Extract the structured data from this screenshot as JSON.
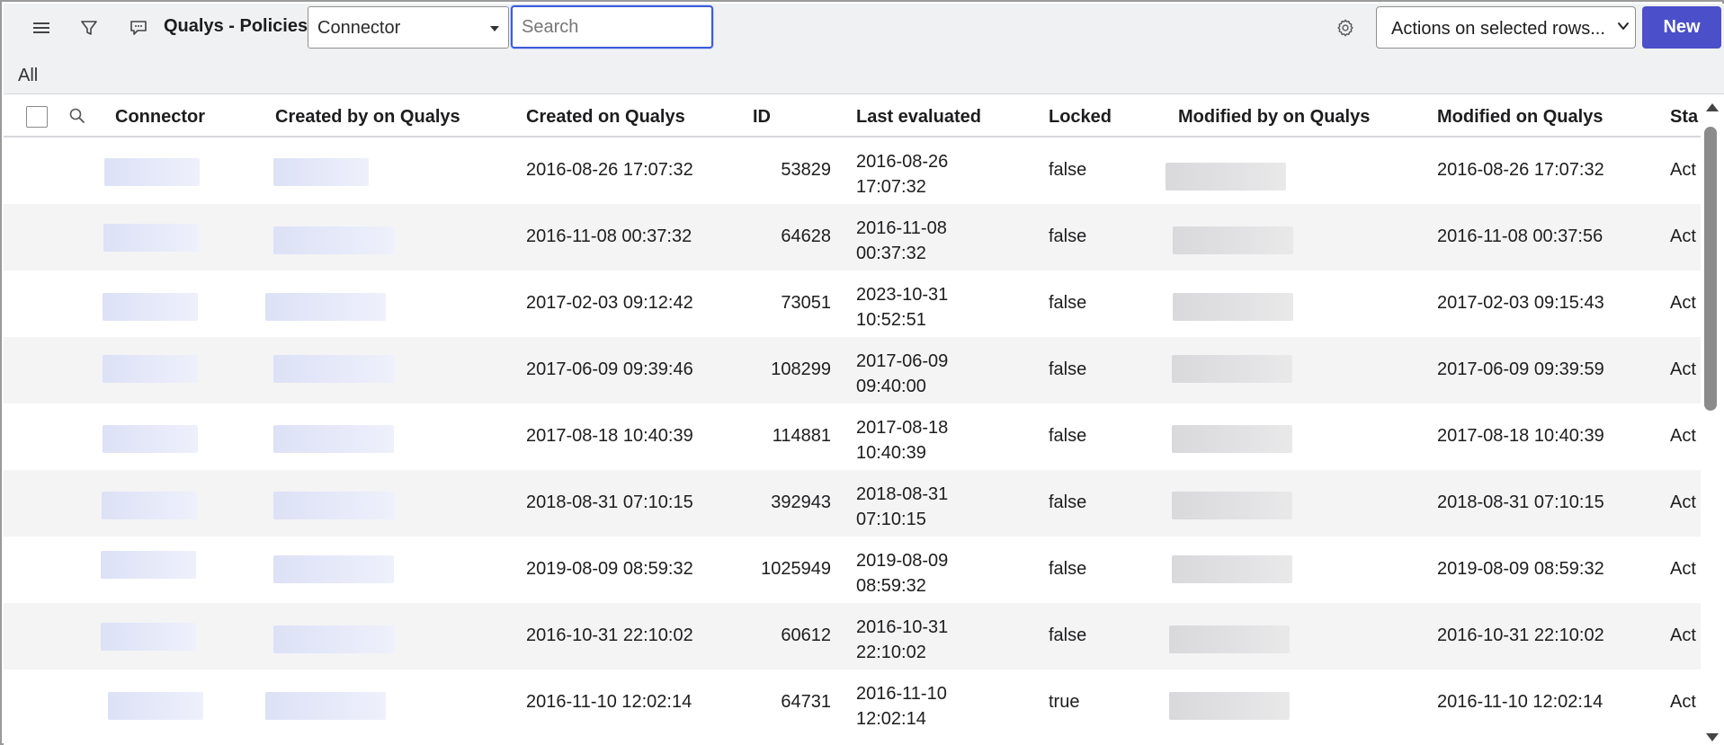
{
  "toolbar": {
    "title": "Qualys - Policies",
    "field_select": "Connector",
    "search_placeholder": "Search",
    "actions_select": "Actions on selected rows...",
    "new_label": "New"
  },
  "breadcrumb": "All",
  "columns": [
    "Connector",
    "Created by on Qualys",
    "Created on Qualys",
    "ID",
    "Last evaluated",
    "Locked",
    "Modified by on Qualys",
    "Modified on Qualys",
    "Sta"
  ],
  "rows": [
    {
      "created_on": "2016-08-26 17:07:32",
      "id": "53829",
      "last_eval_date": "2016-08-26",
      "last_eval_time": "17:07:32",
      "locked": "false",
      "modified_on": "2016-08-26 17:07:32",
      "state": "Act"
    },
    {
      "created_on": "2016-11-08 00:37:32",
      "id": "64628",
      "last_eval_date": "2016-11-08",
      "last_eval_time": "00:37:32",
      "locked": "false",
      "modified_on": "2016-11-08 00:37:56",
      "state": "Act"
    },
    {
      "created_on": "2017-02-03 09:12:42",
      "id": "73051",
      "last_eval_date": "2023-10-31",
      "last_eval_time": "10:52:51",
      "locked": "false",
      "modified_on": "2017-02-03 09:15:43",
      "state": "Act"
    },
    {
      "created_on": "2017-06-09 09:39:46",
      "id": "108299",
      "last_eval_date": "2017-06-09",
      "last_eval_time": "09:40:00",
      "locked": "false",
      "modified_on": "2017-06-09 09:39:59",
      "state": "Act"
    },
    {
      "created_on": "2017-08-18 10:40:39",
      "id": "114881",
      "last_eval_date": "2017-08-18",
      "last_eval_time": "10:40:39",
      "locked": "false",
      "modified_on": "2017-08-18 10:40:39",
      "state": "Act"
    },
    {
      "created_on": "2018-08-31 07:10:15",
      "id": "392943",
      "last_eval_date": "2018-08-31",
      "last_eval_time": "07:10:15",
      "locked": "false",
      "modified_on": "2018-08-31 07:10:15",
      "state": "Act"
    },
    {
      "created_on": "2019-08-09 08:59:32",
      "id": "1025949",
      "last_eval_date": "2019-08-09",
      "last_eval_time": "08:59:32",
      "locked": "false",
      "modified_on": "2019-08-09 08:59:32",
      "state": "Act"
    },
    {
      "created_on": "2016-10-31 22:10:02",
      "id": "60612",
      "last_eval_date": "2016-10-31",
      "last_eval_time": "22:10:02",
      "locked": "false",
      "modified_on": "2016-10-31 22:10:02",
      "state": "Act"
    },
    {
      "created_on": "2016-11-10 12:02:14",
      "id": "64731",
      "last_eval_date": "2016-11-10",
      "last_eval_time": "12:02:14",
      "locked": "true",
      "modified_on": "2016-11-10 12:02:14",
      "state": "Act"
    }
  ],
  "icons": {
    "menu": "hamburger-menu-icon",
    "filter": "filter-funnel-icon",
    "comments": "speech-bubble-icon",
    "settings": "gear-icon",
    "column_search": "search-icon"
  },
  "colors": {
    "primary_button": "#4b4fc9",
    "search_focus": "#3d5bd8",
    "alt_row": "#f4f4f5"
  }
}
